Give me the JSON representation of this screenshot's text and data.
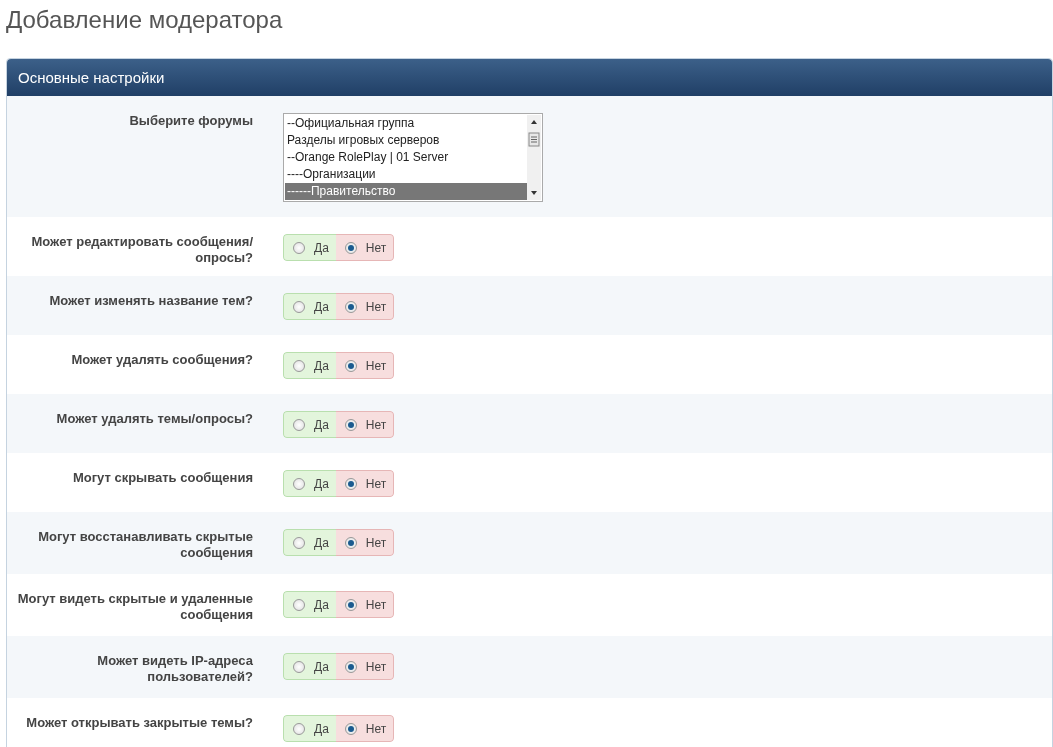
{
  "page_title": "Добавление модератора",
  "panel": {
    "title": "Основные настройки",
    "forum_select": {
      "label": "Выберите форумы",
      "options": [
        {
          "text": "--Официальная группа",
          "selected": false
        },
        {
          "text": "Разделы игровых серверов",
          "selected": false
        },
        {
          "text": "--Orange RolePlay | 01 Server",
          "selected": false
        },
        {
          "text": "----Организации",
          "selected": false
        },
        {
          "text": "------Правительство",
          "selected": true
        }
      ]
    },
    "settings": [
      {
        "label": "Может редактировать сообщения/опросы?",
        "options": [
          {
            "kind": "yes",
            "label": "Да",
            "selected": false
          },
          {
            "kind": "no",
            "label": "Нет",
            "selected": true
          }
        ]
      },
      {
        "label": "Может изменять название тем?",
        "options": [
          {
            "kind": "yes",
            "label": "Да",
            "selected": false
          },
          {
            "kind": "no",
            "label": "Нет",
            "selected": true
          }
        ]
      },
      {
        "label": "Может удалять сообщения?",
        "options": [
          {
            "kind": "yes",
            "label": "Да",
            "selected": false
          },
          {
            "kind": "no",
            "label": "Нет",
            "selected": true
          }
        ]
      },
      {
        "label": "Может удалять темы/опросы?",
        "options": [
          {
            "kind": "yes",
            "label": "Да",
            "selected": false
          },
          {
            "kind": "no",
            "label": "Нет",
            "selected": true
          }
        ]
      },
      {
        "label": "Могут скрывать сообщения",
        "options": [
          {
            "kind": "yes",
            "label": "Да",
            "selected": false
          },
          {
            "kind": "no",
            "label": "Нет",
            "selected": true
          }
        ]
      },
      {
        "label": "Могут восстанавливать скрытые сообщения",
        "options": [
          {
            "kind": "yes",
            "label": "Да",
            "selected": false
          },
          {
            "kind": "no",
            "label": "Нет",
            "selected": true
          }
        ]
      },
      {
        "label": "Могут видеть скрытые и удаленные сообщения",
        "options": [
          {
            "kind": "yes",
            "label": "Да",
            "selected": false
          },
          {
            "kind": "no",
            "label": "Нет",
            "selected": true
          }
        ]
      },
      {
        "label": "Может видеть IP-адреса пользователей?",
        "options": [
          {
            "kind": "yes",
            "label": "Да",
            "selected": false
          },
          {
            "kind": "no",
            "label": "Нет",
            "selected": true
          }
        ]
      },
      {
        "label": "Может открывать закрытые темы?",
        "options": [
          {
            "kind": "yes",
            "label": "Да",
            "selected": false
          },
          {
            "kind": "no",
            "label": "Нет",
            "selected": true
          }
        ]
      }
    ]
  }
}
